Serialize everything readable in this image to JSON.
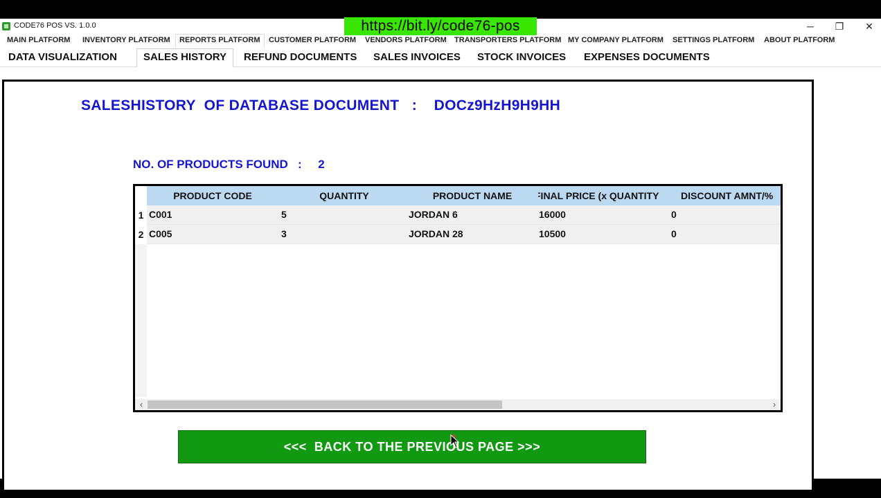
{
  "window": {
    "title": "CODE76 POS VS. 1.0.0",
    "url_banner": "https://bit.ly/code76-pos",
    "controls": {
      "minimize": "─",
      "restore": "❐",
      "close": "✕"
    }
  },
  "top_nav": {
    "tabs": [
      {
        "label": "MAIN PLATFORM"
      },
      {
        "label": "INVENTORY PLATFORM"
      },
      {
        "label": "REPORTS PLATFORM",
        "active": true
      },
      {
        "label": "CUSTOMER PLATFORM"
      },
      {
        "label": "VENDORS PLATFORM"
      },
      {
        "label": "TRANSPORTERS PLATFORM"
      },
      {
        "label": "MY COMPANY PLATFORM"
      },
      {
        "label": "SETTINGS PLATFORM"
      },
      {
        "label": "ABOUT PLATFORM"
      }
    ]
  },
  "sub_nav": {
    "tabs": [
      {
        "label": "DATA VISUALIZATION"
      },
      {
        "label": "SALES HISTORY",
        "active": true
      },
      {
        "label": "REFUND DOCUMENTS"
      },
      {
        "label": "SALES INVOICES"
      },
      {
        "label": "STOCK INVOICES"
      },
      {
        "label": "EXPENSES DOCUMENTS"
      }
    ]
  },
  "main": {
    "heading": "SALESHISTORY  OF DATABASE DOCUMENT   :    DOCz9HzH9H9HH",
    "found_label": "NO. OF PRODUCTS FOUND   :",
    "found_count": "2",
    "grid": {
      "columns": [
        "PRODUCT CODE",
        "QUANTITY",
        "PRODUCT NAME",
        "FINAL PRICE (x QUANTITY",
        "DISCOUNT AMNT/%"
      ],
      "rows": [
        {
          "num": "1",
          "code": "C001",
          "quantity": "5",
          "name": "JORDAN 6",
          "final_price": "16000",
          "discount": "0"
        },
        {
          "num": "2",
          "code": "C005",
          "quantity": "3",
          "name": "JORDAN 28",
          "final_price": "10500",
          "discount": "0"
        }
      ],
      "scroll_left": "‹",
      "scroll_right": "›"
    },
    "back_button": "<<<  BACK TO THE PREVIOUS PAGE >>>"
  },
  "colors": {
    "heading_blue": "#1515d0",
    "header_row": "#bcd9f2",
    "button_green": "#119a11",
    "banner_green": "#39e600"
  }
}
